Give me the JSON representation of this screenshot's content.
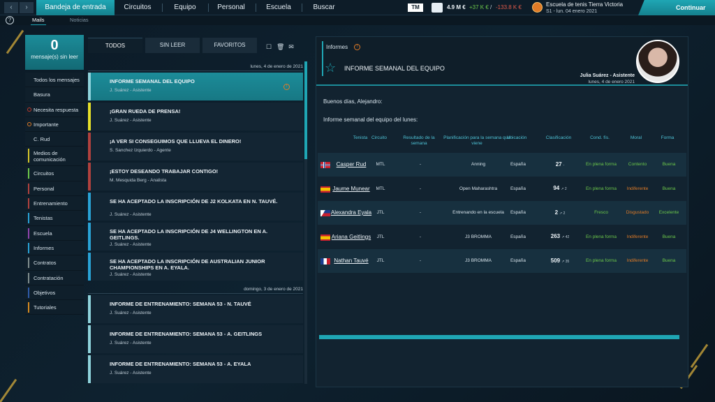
{
  "topbar": {
    "tabs": [
      "Bandeja de entrada",
      "Circuitos",
      "Equipo",
      "Personal",
      "Escuela",
      "Buscar"
    ],
    "brand": "TM",
    "money": "4.9 M €",
    "income": "+37 K €",
    "divider": "/",
    "expense": "-133.8 K €",
    "club_name": "Escuela de tenis Tierra Victoria",
    "club_date": "S1 - lun. 04 enero 2021",
    "continue_label": "Continuar",
    "nav_prev": "‹",
    "nav_next": "›"
  },
  "subbar": {
    "help": "?",
    "tabs": [
      "Mails",
      "Noticias"
    ]
  },
  "sidebar": {
    "unread_count": "0",
    "unread_label": "mensaje(s) sin leer",
    "items": [
      {
        "label": "Todos los mensajes",
        "color": ""
      },
      {
        "label": "Basura",
        "color": ""
      },
      {
        "label": "Necesita respuesta",
        "color": "#c0392b"
      },
      {
        "label": "Importante",
        "color": "#e07b27"
      },
      {
        "label": "C. Rud",
        "color": ""
      },
      {
        "label": "Medios de comunicación",
        "color": "#d4c62a"
      },
      {
        "label": "Circuitos",
        "color": "#6cc84a"
      },
      {
        "label": "Personal",
        "color": "#b0413e"
      },
      {
        "label": "Entrenamiento",
        "color": "#b0413e"
      },
      {
        "label": "Tenistas",
        "color": "#29a3d6"
      },
      {
        "label": "Escuela",
        "color": "#8e44ad"
      },
      {
        "label": "Informes",
        "color": "#29a3d6"
      },
      {
        "label": "Contratos",
        "color": "#7f8c8d"
      },
      {
        "label": "Contratación",
        "color": "#7f8c8d"
      },
      {
        "label": "Objetivos",
        "color": "#2e5aa8"
      },
      {
        "label": "Tutoriales",
        "color": "#d68a1f"
      }
    ]
  },
  "mail_filters": [
    "TODOS",
    "SIN LEER",
    "FAVORITOS"
  ],
  "mail_tools": [
    "☐",
    "🗑",
    "✉"
  ],
  "mail_groups": [
    {
      "date": "lunes, 4 de enero de 2021",
      "items": [
        {
          "title": "INFORME SEMANAL DEL EQUIPO",
          "sender": "J. Suárez - Asistente",
          "color": "#8fd3dc",
          "flag": "!"
        },
        {
          "title": "¡GRAN RUEDA DE PRENSA!",
          "sender": "J. Suárez - Asistente",
          "color": "#e6e02a",
          "flag": ""
        },
        {
          "title": "¡A VER SI CONSEGUIMOS QUE LLUEVA EL DINERO!",
          "sender": "S. Sanchez Izquierdo - Agente",
          "color": "#b0413e",
          "flag": ""
        },
        {
          "title": "¡ESTOY DESEANDO TRABAJAR CONTIGO!",
          "sender": "M. Mesquida Berg - Analista",
          "color": "#b0413e",
          "flag": ""
        },
        {
          "title": "SE HA ACEPTADO LA INSCRIPCIÓN DE J2 KOLKATA EN N. TAUVÉ.",
          "sender": "J. Suárez - Asistente",
          "color": "#29a3d6",
          "flag": ""
        },
        {
          "title": "SE HA ACEPTADO LA INSCRIPCIÓN DE J4 WELLINGTON EN A. GEITLINGS.",
          "sender": "J. Suárez - Asistente",
          "color": "#29a3d6",
          "flag": ""
        },
        {
          "title": "SE HA ACEPTADO LA INSCRIPCIÓN DE AUSTRALIAN JUNIOR CHAMPIONSHIPS EN A. EYALA.",
          "sender": "J. Suárez - Asistente",
          "color": "#29a3d6",
          "flag": ""
        }
      ]
    },
    {
      "date": "domingo, 3 de enero de 2021",
      "items": [
        {
          "title": "INFORME DE ENTRENAMIENTO: SEMANA 53 - N. TAUVÉ",
          "sender": "J. Suárez - Asistente",
          "color": "#8fd3dc",
          "flag": ""
        },
        {
          "title": "INFORME DE ENTRENAMIENTO: SEMANA 53 - A. GEITLINGS",
          "sender": "J. Suárez - Asistente",
          "color": "#8fd3dc",
          "flag": ""
        },
        {
          "title": "INFORME DE ENTRENAMIENTO: SEMANA 53 - A. EYALA",
          "sender": "J. Suárez - Asistente",
          "color": "#8fd3dc",
          "flag": ""
        }
      ]
    }
  ],
  "report": {
    "category": "Informes",
    "warn": "!",
    "star": "☆",
    "title": "INFORME SEMANAL DEL EQUIPO",
    "sender_name": "Julia Suárez - Asistente",
    "sender_date": "lunes, 4 de enero 2021",
    "greeting": "Buenos días, Alejandro:",
    "intro": "Informe semanal del equipo del lunes:",
    "columns": [
      "Tenista",
      "Circuito",
      "Resultado de la semana",
      "Planificación para la semana que viene",
      "Ubicación",
      "Clasificación",
      "Cond. fís.",
      "Moral",
      "Forma"
    ],
    "rows": [
      {
        "flag": "NO",
        "name": "Casper Rud",
        "circuit": "MTL",
        "result": "-",
        "plan": "Anning",
        "location": "España",
        "rank": "27",
        "rank_delta": "-",
        "condition": "En plena forma",
        "moral": "Contento",
        "moral_color": "green",
        "form": "Buena"
      },
      {
        "flag": "ES",
        "name": "Jaume Munear",
        "circuit": "MTL",
        "result": "-",
        "plan": "Open Maharashtra",
        "location": "España",
        "rank": "94",
        "rank_delta": "↗ 2",
        "condition": "En plena forma",
        "moral": "Indiferente",
        "moral_color": "orange",
        "form": "Buena"
      },
      {
        "flag": "PH",
        "name": "Alexandra Eyala",
        "circuit": "JTL",
        "result": "-",
        "plan": "Entrenando en la escuela",
        "location": "España",
        "rank": "2",
        "rank_delta": "↗ 2",
        "condition": "Fresco",
        "moral": "Disgustado",
        "moral_color": "orange",
        "form": "Excelente"
      },
      {
        "flag": "ES",
        "name": "Ariana Geitlings",
        "circuit": "JTL",
        "result": "-",
        "plan": "J3 BROMMA",
        "location": "España",
        "rank": "263",
        "rank_delta": "↗ 42",
        "condition": "En plena forma",
        "moral": "Indiferente",
        "moral_color": "orange",
        "form": "Buena"
      },
      {
        "flag": "FR",
        "name": "Nathan Tauvé",
        "circuit": "JTL",
        "result": "-",
        "plan": "J3 BROMMA",
        "location": "España",
        "rank": "509",
        "rank_delta": "↗ 35",
        "condition": "En plena forma",
        "moral": "Indiferente",
        "moral_color": "orange",
        "form": "Buena"
      }
    ]
  },
  "colors": {
    "accent": "#1fa6b4",
    "good": "#6cc84a",
    "warn": "#e07b27"
  }
}
